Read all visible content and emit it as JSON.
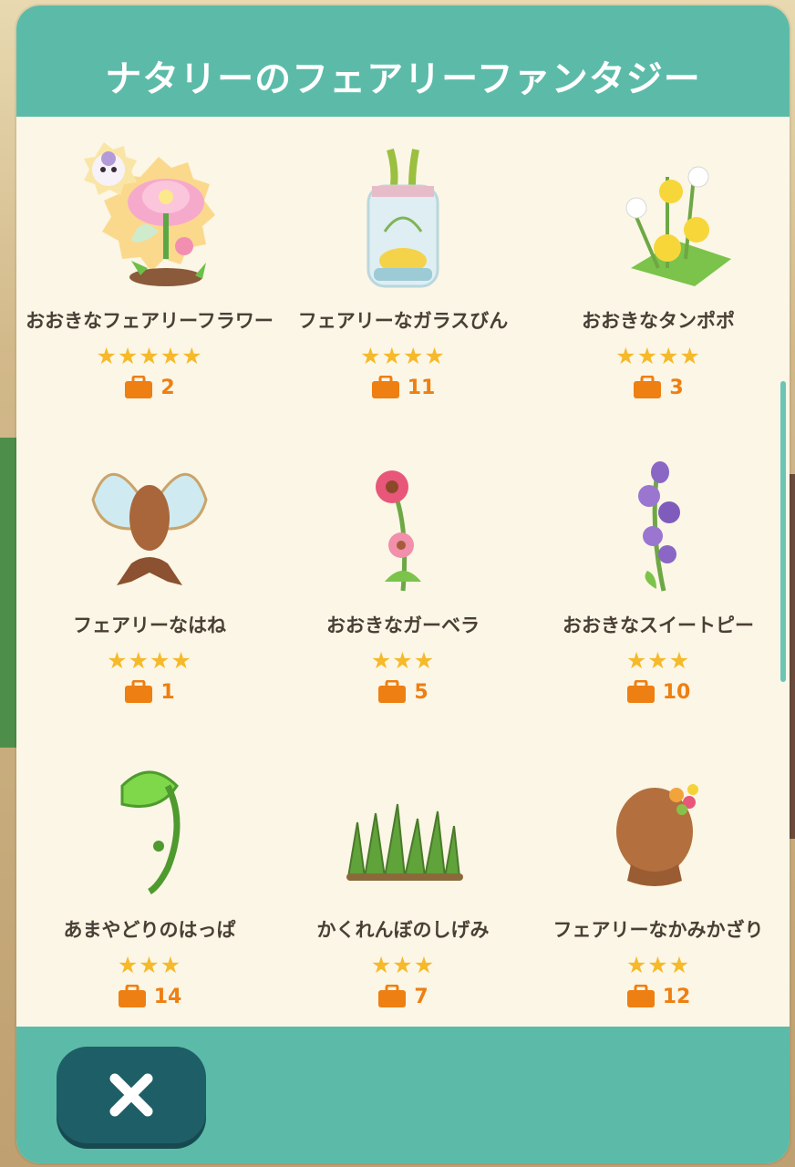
{
  "title": "ナタリーのフェアリーファンタジー",
  "items": [
    {
      "name": "おおきなフェアリーフラワー",
      "stars": "★★★★★",
      "count": "2"
    },
    {
      "name": "フェアリーなガラスびん",
      "stars": "★★★★",
      "count": "11"
    },
    {
      "name": "おおきなタンポポ",
      "stars": "★★★★",
      "count": "3"
    },
    {
      "name": "フェアリーなはね",
      "stars": "★★★★",
      "count": "1"
    },
    {
      "name": "おおきなガーベラ",
      "stars": "★★★",
      "count": "5"
    },
    {
      "name": "おおきなスイートピー",
      "stars": "★★★",
      "count": "10"
    },
    {
      "name": "あまやどりのはっぱ",
      "stars": "★★★",
      "count": "14"
    },
    {
      "name": "かくれんぼのしげみ",
      "stars": "★★★",
      "count": "7"
    },
    {
      "name": "フェアリーなかみかざり",
      "stars": "★★★",
      "count": "12"
    }
  ],
  "colors": {
    "header": "#5bbba8",
    "panel": "#fbf6e6",
    "star": "#f6b92a",
    "count": "#ee7f12",
    "close_button": "#1e5e66"
  },
  "icons": {
    "close": "close-icon",
    "bag": "bag-icon"
  }
}
